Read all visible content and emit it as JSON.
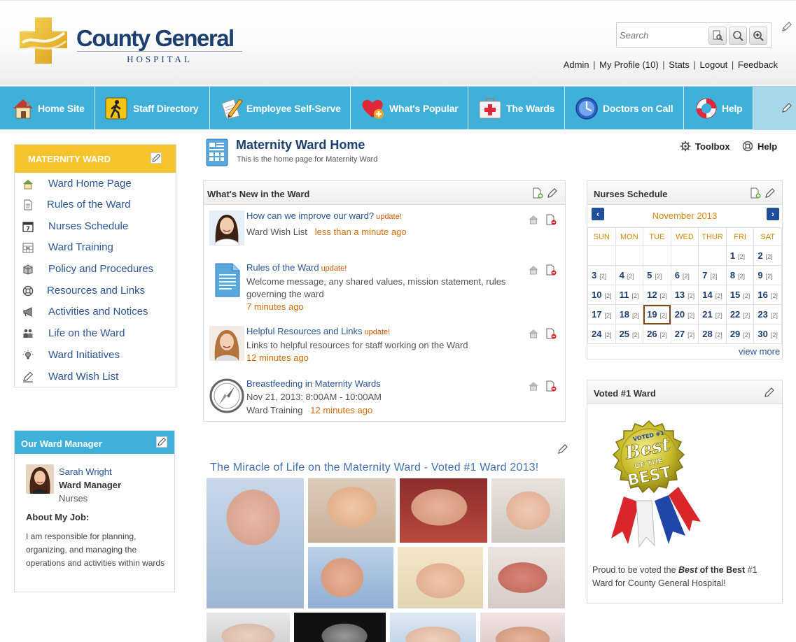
{
  "brand": {
    "name": "County General",
    "subtitle": "HOSPITAL"
  },
  "search": {
    "placeholder": "Search"
  },
  "user_links": [
    "Admin",
    "My Profile (10)",
    "Stats",
    "Logout",
    "Feedback"
  ],
  "nav": [
    {
      "label": "Home Site",
      "icon": "home-icon"
    },
    {
      "label": "Staff Directory",
      "icon": "walking-person-icon"
    },
    {
      "label": "Employee Self-Serve",
      "icon": "pencil-paper-icon"
    },
    {
      "label": "What's Popular",
      "icon": "heart-icon"
    },
    {
      "label": "The Wards",
      "icon": "first-aid-kit-icon"
    },
    {
      "label": "Doctors on Call",
      "icon": "clock-icon"
    },
    {
      "label": "Help",
      "icon": "lifebuoy-icon"
    }
  ],
  "ward_nav": {
    "title": "MATERNITY WARD",
    "items": [
      {
        "label": "Ward Home Page",
        "icon": "home-icon"
      },
      {
        "label": "Rules of the Ward",
        "icon": "document-icon"
      },
      {
        "label": "Nurses Schedule",
        "icon": "calendar-icon"
      },
      {
        "label": "Ward Training",
        "icon": "calendar-grid-icon"
      },
      {
        "label": "Policy and Procedures",
        "icon": "books-icon"
      },
      {
        "label": "Resources and Links",
        "icon": "lifebuoy-icon"
      },
      {
        "label": "Activities and Notices",
        "icon": "megaphone-icon"
      },
      {
        "label": "Life on the Ward",
        "icon": "people-icon"
      },
      {
        "label": "Ward Initiatives",
        "icon": "lightbulb-icon"
      },
      {
        "label": "Ward Wish List",
        "icon": "edit-icon"
      }
    ]
  },
  "manager": {
    "title": "Our Ward Manager",
    "name": "Sarah Wright",
    "role": "Ward Manager",
    "dept": "Nurses",
    "about_label": "About My Job:",
    "about_text": "I am responsible for planning, organizing, and managing the operations and activities within wards"
  },
  "page": {
    "title": "Maternity Ward Home",
    "subtitle": "This is the home page for Maternity Ward",
    "toolbox": "Toolbox",
    "help": "Help"
  },
  "news": {
    "title": "What's New in the Ward",
    "items": [
      {
        "title": "How can we improve our ward?",
        "badge": "update!",
        "source": "Ward Wish List",
        "time": "less than a minute ago"
      },
      {
        "title": "Rules of the Ward",
        "badge": "update!",
        "desc": "Welcome message, any shared values, mission statement, rules governing the ward",
        "time": "7 minutes ago"
      },
      {
        "title": "Helpful Resources and Links",
        "badge": "update!",
        "desc": "Links to helpful resources for staff working on the Ward",
        "time": "12 minutes ago"
      },
      {
        "title": "Breastfeeding in Maternity Wards",
        "date": "Nov 21, 2013: 8:00AM - 10:00AM",
        "source": "Ward Training",
        "time": "12 minutes ago"
      }
    ]
  },
  "gallery": {
    "title": "The Miracle of Life on the Maternity Ward - Voted #1 Ward 2013!"
  },
  "schedule": {
    "title": "Nurses Schedule",
    "month": "November 2013",
    "days": [
      "SUN",
      "MON",
      "TUE",
      "WED",
      "THUR",
      "FRI",
      "SAT"
    ],
    "weeks": [
      [
        null,
        null,
        null,
        null,
        null,
        1,
        2
      ],
      [
        3,
        4,
        5,
        6,
        7,
        8,
        9
      ],
      [
        10,
        11,
        12,
        13,
        14,
        15,
        16
      ],
      [
        17,
        18,
        19,
        20,
        21,
        22,
        23
      ],
      [
        24,
        25,
        26,
        27,
        28,
        29,
        30
      ]
    ],
    "count_label": "[2]",
    "today": 19,
    "view_more": "view more"
  },
  "voted": {
    "title": "Voted #1 Ward",
    "badge_top": "VOTED #1",
    "badge_main": "Best",
    "badge_of": "OF THE",
    "badge_best": "BEST",
    "text_pre": "Proud to be voted the ",
    "text_bold": "Best",
    "text_mid": " of the Best",
    "text_post": " #1 Ward for County General Hospital!"
  },
  "colors": {
    "nav_blue": "#3fb0d9",
    "ward_yellow": "#f5c32c",
    "brand_navy": "#1d3f70",
    "link_blue": "#2c5596",
    "time_orange": "#d4700c"
  }
}
